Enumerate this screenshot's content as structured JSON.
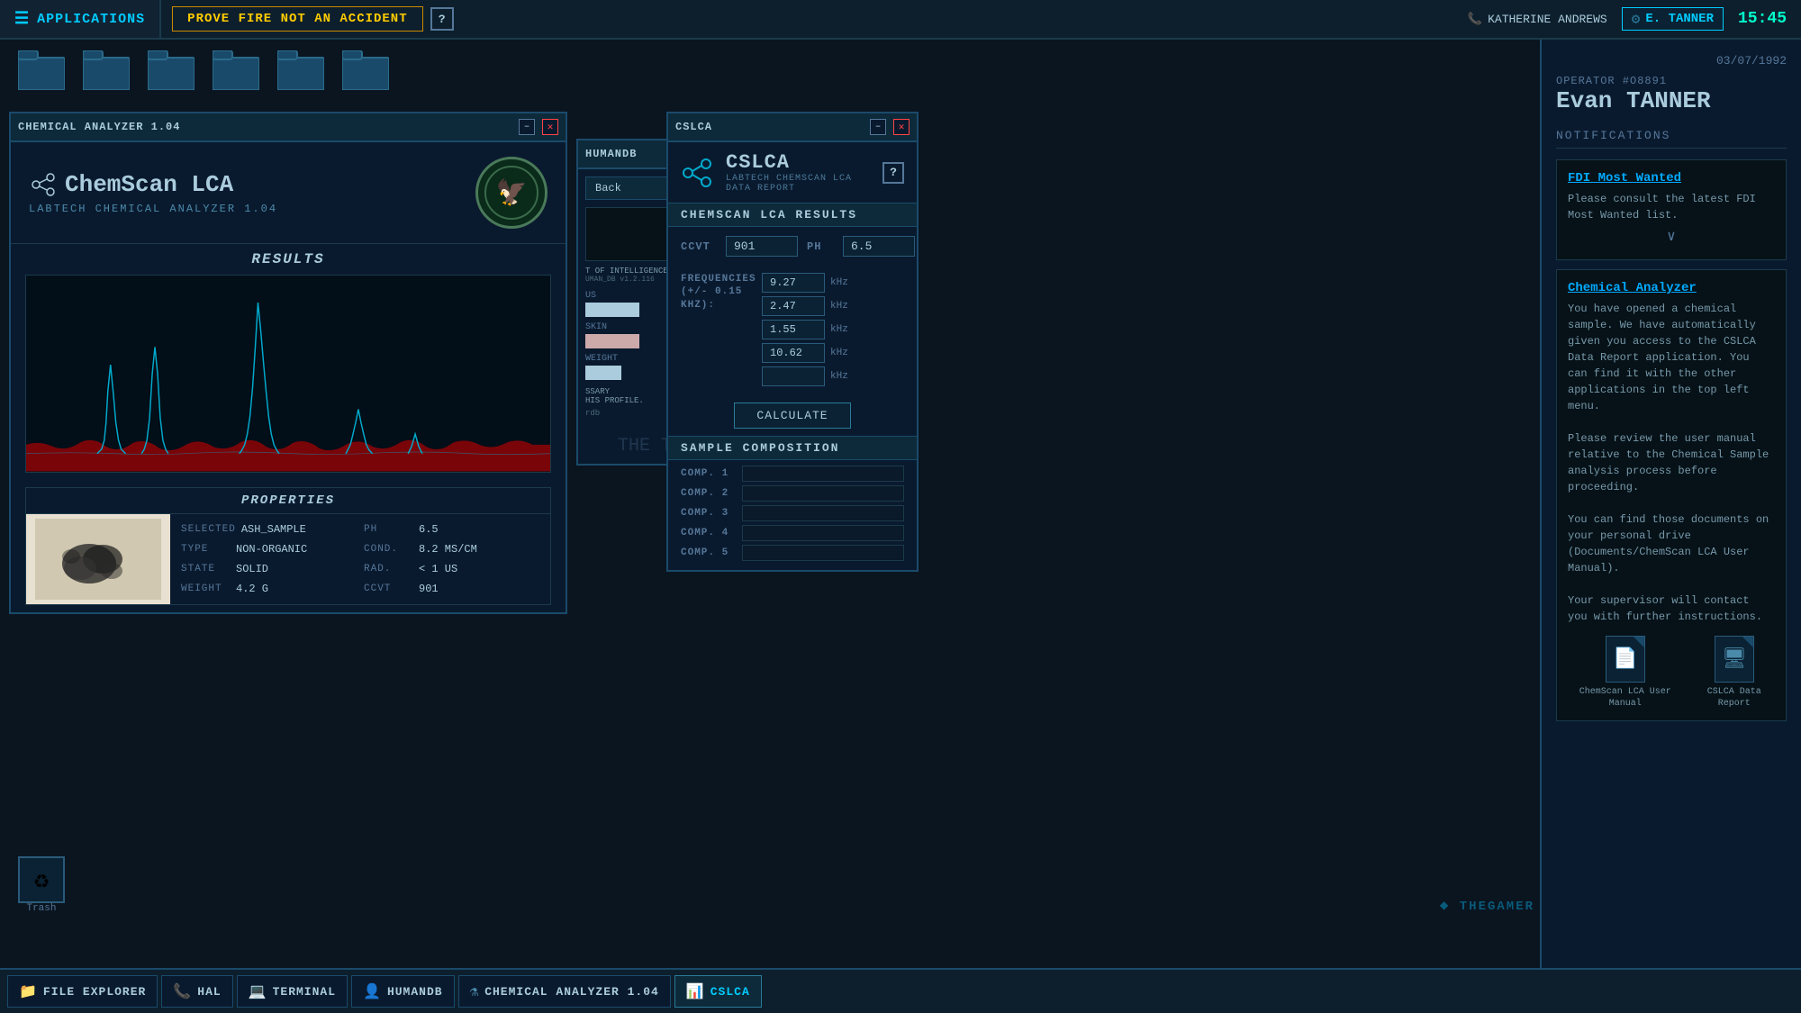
{
  "topbar": {
    "apps_label": "APPLICATIONS",
    "task_label": "PROVE FIRE NOT AN ACCIDENT",
    "help_label": "?",
    "user_phone": "KATHERINE ANDREWS",
    "user_name": "E. TANNER",
    "time": "15:45"
  },
  "desktop": {
    "date": "03/07/1992",
    "folder_icons": [
      "folder1",
      "folder2",
      "folder3",
      "folder4",
      "folder5",
      "folder6"
    ],
    "trash_label": "Trash"
  },
  "chem_analyzer": {
    "window_title": "CHEMICAL ANALYZER 1.04",
    "minimize": "–",
    "close": "✕",
    "logo_title": "ChemScan LCA",
    "logo_subtitle": "LaBTech Chemical Analyzer 1.04",
    "results_title": "Results",
    "properties_title": "Properties",
    "selected_label": "SELECTED",
    "selected_value": "Ash_sample",
    "type_label": "TYPE",
    "type_value": "Non-organic",
    "state_label": "STATE",
    "state_value": "Solid",
    "weight_label": "WEIGHT",
    "weight_value": "4.2 G",
    "ph_label": "PH",
    "ph_value": "6.5",
    "cond_label": "COND.",
    "cond_value": "8.2 MS/CM",
    "rad_label": "RAD.",
    "rad_value": "< 1 US",
    "ccvt_label": "CCVT",
    "ccvt_value": "901"
  },
  "cslca_window": {
    "window_title": "CSLCA",
    "minimize": "–",
    "close": "✕"
  },
  "cslca_report": {
    "window_title": "CSLCA",
    "minimize": "–",
    "close": "✕",
    "main_title": "CSLCA",
    "subtitle": "LaBTech ChemScan LCA Data Report",
    "help_label": "?",
    "section_title": "ChemScan LCA Results",
    "ccvt_label": "CCVT",
    "ccvt_value": "901",
    "ph_label": "pH",
    "ph_value": "6.5",
    "freq_label": "Frequencies\n(+/- 0.15 kHz):",
    "freq_values": [
      "9.27",
      "2.47",
      "1.55",
      "10.62",
      ""
    ],
    "freq_unit": "kHz",
    "calculate_label": "Calculate",
    "composition_title": "Sample Composition",
    "comp_rows": [
      "COMP. 1",
      "COMP. 2",
      "COMP. 3",
      "COMP. 4",
      "COMP. 5"
    ]
  },
  "humandb_window": {
    "window_title": "HUMANDB",
    "back_label": "Back",
    "dept_label": "T OF INTELLIGENCE",
    "humandb_label": "UMAN_DB v1.2.116",
    "us_label": "US",
    "skin_label": "SKIN",
    "weight_label": "WEIGHT",
    "necessary_label": "SSARY",
    "profile_label": "HIS PROFILE."
  },
  "right_panel": {
    "operator_label": "Operator #O8891",
    "operator_name": "Evan TANNER",
    "notifications_title": "Notifications",
    "notif1_title": "FDI Most Wanted",
    "notif1_text": "Please consult the latest FDI Most Wanted list.",
    "notif2_title": "Chemical Analyzer",
    "notif2_text": "You have opened a chemical sample. We have automatically given you access to the CSLCA Data Report application. You can find it with the other applications in the top left menu.\n\nPlease review the user manual relative to the Chemical Sample analysis process before proceeding.\n\nYou can find those documents on your personal drive (Documents/ChemScan LCA User Manual).\n\nYour supervisor will contact you with further instructions.",
    "doc1_label": "ChemScan LCA User Manual",
    "doc2_label": "CSLCA Data Report",
    "thegamer_label": "THEGAMER"
  },
  "taskbar": {
    "items": [
      {
        "label": "FILE EXPLORER",
        "icon": "📁",
        "active": false
      },
      {
        "label": "HAL",
        "icon": "📞",
        "active": false
      },
      {
        "label": "TERMINAL",
        "icon": "💻",
        "active": false
      },
      {
        "label": "HUMANDB",
        "icon": "👤",
        "active": false
      },
      {
        "label": "CHEMICAL ANALYZER 1.04",
        "icon": "⚗",
        "active": false
      },
      {
        "label": "CSLCA",
        "icon": "📊",
        "active": true
      }
    ]
  }
}
